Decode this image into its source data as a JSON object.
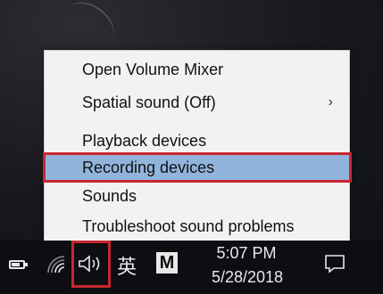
{
  "context_menu": {
    "items": [
      {
        "label": "Open Volume Mixer",
        "has_submenu": false,
        "highlighted": false
      },
      {
        "label": "Spatial sound (Off)",
        "has_submenu": true,
        "highlighted": false
      },
      {
        "label": "Playback devices",
        "has_submenu": false,
        "highlighted": false
      },
      {
        "label": "Recording devices",
        "has_submenu": false,
        "highlighted": true
      },
      {
        "label": "Sounds",
        "has_submenu": false,
        "highlighted": false
      },
      {
        "label": "Troubleshoot sound problems",
        "has_submenu": false,
        "highlighted": false
      }
    ],
    "submenu_glyph": "›"
  },
  "taskbar": {
    "icons": [
      "battery-icon",
      "wifi-icon",
      "speaker-icon",
      "ime-icon",
      "m-icon",
      "notification-icon"
    ],
    "ime_label": "英",
    "m_label": "M",
    "time": "5:07 PM",
    "date": "5/28/2018"
  },
  "colors": {
    "highlight": "#91b4dc",
    "callout_border": "#c8262f",
    "menu_bg": "#f2f2f2",
    "taskbar_bg": "#0c0e12"
  }
}
